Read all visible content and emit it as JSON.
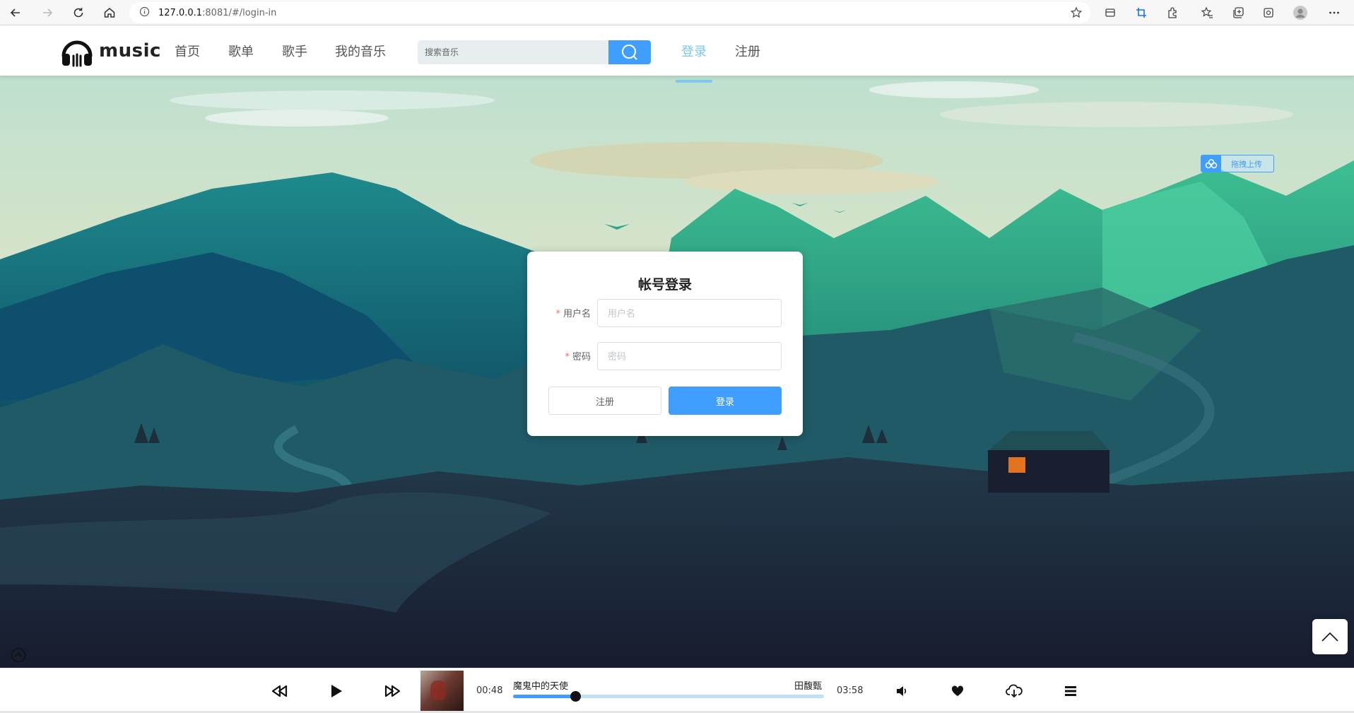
{
  "browser": {
    "url_host": "127.0.0.1",
    "url_path": ":8081/#/login-in"
  },
  "header": {
    "logo": "music",
    "nav": [
      "首页",
      "歌单",
      "歌手",
      "我的音乐"
    ],
    "search_placeholder": "搜索音乐",
    "login": "登录",
    "register": "注册",
    "active_color": "#7ac8f2",
    "accent": "#409eff"
  },
  "upload": {
    "label": "拖拽上传"
  },
  "login_form": {
    "title": "帐号登录",
    "username_label": "用户名",
    "username_placeholder": "用户名",
    "password_label": "密码",
    "password_placeholder": "密码",
    "register_button": "注册",
    "login_button": "登录"
  },
  "player": {
    "current_time": "00:48",
    "total_time": "03:58",
    "song_title": "魔鬼中的天使",
    "artist": "田馥甄",
    "progress": 0.2
  }
}
